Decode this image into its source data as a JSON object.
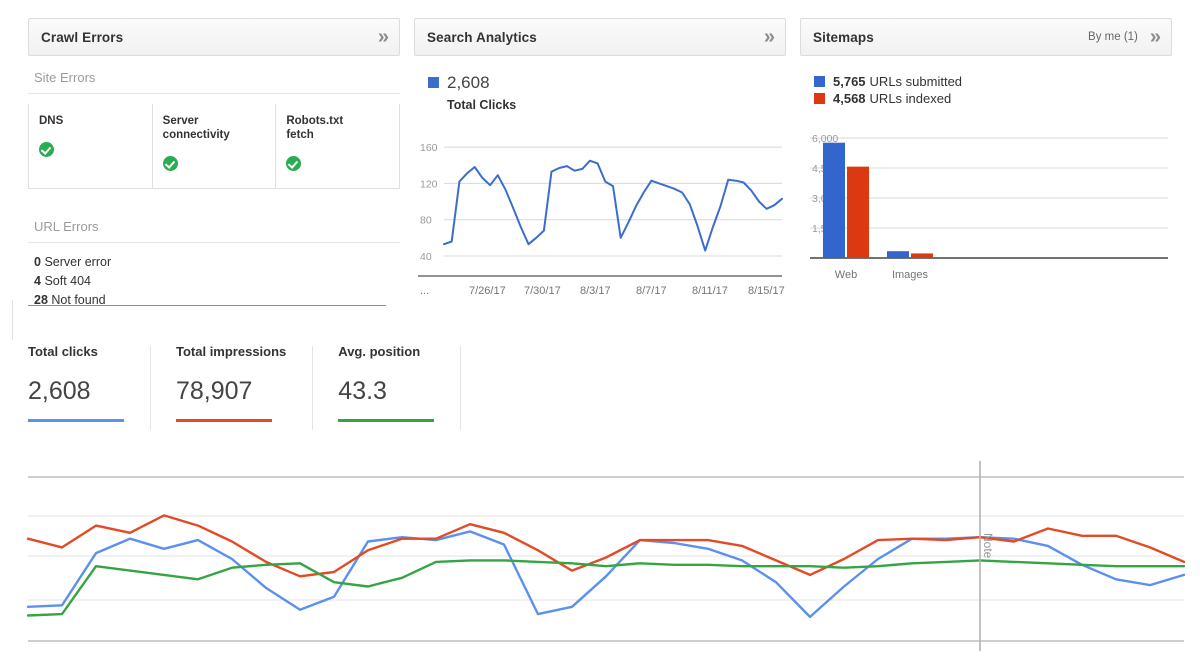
{
  "panels": {
    "crawl_errors": {
      "title": "Crawl Errors",
      "expand_icon": "»",
      "site_errors_label": "Site Errors",
      "site_errors": [
        {
          "name": "DNS",
          "status": "ok"
        },
        {
          "name": "Server connectivity",
          "status": "ok"
        },
        {
          "name": "Robots.txt fetch",
          "status": "ok"
        }
      ],
      "url_errors_label": "URL Errors",
      "url_errors": [
        {
          "count": "0",
          "label": "Server error"
        },
        {
          "count": "4",
          "label": "Soft 404"
        },
        {
          "count": "28",
          "label": "Not found"
        }
      ]
    },
    "search_analytics": {
      "title": "Search Analytics",
      "expand_icon": "»",
      "metric_value": "2,608",
      "metric_label": "Total Clicks",
      "series_color": "#3b6ecc"
    },
    "sitemaps": {
      "title": "Sitemaps",
      "subtitle": "By me (1)",
      "expand_icon": "»",
      "legend": [
        {
          "value": "5,765",
          "label": "URLs submitted",
          "color": "#3366cc"
        },
        {
          "value": "4,568",
          "label": "URLs indexed",
          "color": "#dc3912"
        }
      ]
    }
  },
  "metrics": [
    {
      "label": "Total clicks",
      "value": "2,608",
      "color": "#5b8ff0"
    },
    {
      "label": "Total impressions",
      "value": "78,907",
      "color": "#e24b26"
    },
    {
      "label": "Avg. position",
      "value": "43.3",
      "color": "#35a544"
    }
  ],
  "bottom_chart": {
    "note_label": "Note"
  },
  "chart_data": [
    {
      "type": "line",
      "id": "search-analytics-clicks",
      "title": "Total Clicks",
      "xlabel": "",
      "ylabel": "",
      "ylim": [
        40,
        170
      ],
      "yticks": [
        40,
        80,
        120,
        160
      ],
      "grid": true,
      "legend": [
        "Total Clicks"
      ],
      "legend_position": "top-left",
      "xtick_labels": [
        "...",
        "7/26/17",
        "7/30/17",
        "8/3/17",
        "8/7/17",
        "8/11/17",
        "8/15/17"
      ],
      "series": [
        {
          "name": "Total Clicks",
          "color": "#3b6ecc",
          "values": [
            53,
            56,
            122,
            131,
            138,
            126,
            118,
            129,
            113,
            93,
            72,
            53,
            60,
            68,
            133,
            137,
            139,
            134,
            136,
            145,
            142,
            122,
            117,
            60,
            77,
            95,
            110,
            123,
            120,
            117,
            114,
            110,
            97,
            73,
            46,
            72,
            95,
            124,
            123,
            121,
            112,
            100,
            92,
            96,
            103
          ]
        }
      ]
    },
    {
      "type": "bar",
      "id": "sitemaps-indexing",
      "title": "",
      "xlabel": "",
      "ylabel": "",
      "ylim": [
        0,
        6500
      ],
      "yticks": [
        1500,
        3000,
        4500,
        6000
      ],
      "grid": true,
      "categories": [
        "Web",
        "Images"
      ],
      "series": [
        {
          "name": "URLs submitted",
          "color": "#3366cc",
          "values": [
            5765,
            340
          ]
        },
        {
          "name": "URLs indexed",
          "color": "#dc3912",
          "values": [
            4568,
            228
          ]
        }
      ]
    },
    {
      "type": "line",
      "id": "performance-overview",
      "title": "",
      "xlabel": "",
      "ylabel": "",
      "grid": true,
      "gridline_count": 5,
      "annotations": [
        {
          "label": "Note",
          "x_index": 28
        }
      ],
      "series": [
        {
          "name": "Total clicks",
          "color": "#5b8ff0",
          "values": [
            16,
            17,
            53,
            63,
            56,
            62,
            49,
            29,
            14,
            23,
            61,
            64,
            62,
            68,
            59,
            11,
            16,
            37,
            62,
            60,
            56,
            48,
            33,
            9,
            30,
            49,
            63,
            63,
            64,
            63,
            58,
            45,
            35,
            31,
            38
          ]
        },
        {
          "name": "Total impressions",
          "color": "#e24b26",
          "values": [
            63,
            57,
            72,
            67,
            79,
            72,
            61,
            47,
            37,
            40,
            55,
            63,
            63,
            73,
            67,
            55,
            41,
            50,
            62,
            62,
            62,
            58,
            48,
            38,
            49,
            62,
            63,
            62,
            64,
            61,
            70,
            65,
            65,
            57,
            47
          ]
        },
        {
          "name": "Avg. position",
          "color": "#35a544",
          "values": [
            10,
            11,
            44,
            41,
            38,
            35,
            43,
            45,
            46,
            33,
            30,
            36,
            47,
            48,
            48,
            47,
            46,
            44,
            46,
            45,
            45,
            44,
            44,
            44,
            43,
            44,
            46,
            47,
            48,
            47,
            46,
            45,
            44,
            44,
            44
          ]
        }
      ]
    }
  ]
}
